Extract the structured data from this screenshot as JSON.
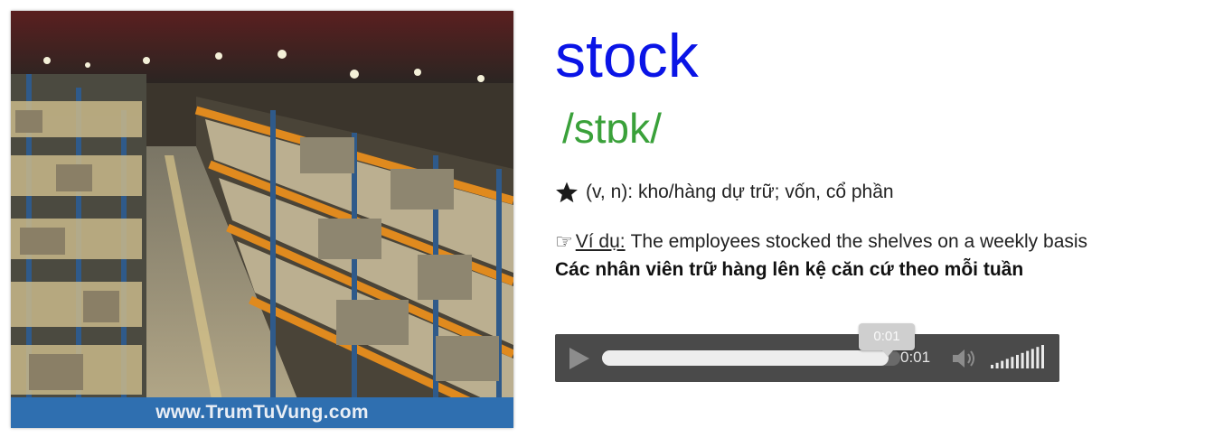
{
  "illustration": {
    "watermark": "www.TrumTuVung.com",
    "alt_icon": "warehouse-illustration"
  },
  "entry": {
    "word": "stock",
    "phonetic": "/stɒk/",
    "definition": "(v, n): kho/hàng dự trữ; vốn, cổ phần",
    "example_label": "Ví dụ:",
    "example_text": "The employees stocked the shelves on a weekly basis",
    "translation": "Các nhân viên trữ hàng lên kệ căn cứ theo mỗi tuần"
  },
  "player": {
    "current_time": "0:01",
    "tooltip_time": "0:01",
    "progress": 0.96,
    "volume_level": 1.0,
    "play_icon": "play-icon",
    "volume_icon": "speaker-icon"
  },
  "colors": {
    "word": "#0a14e6",
    "phonetic": "#3aa13a",
    "watermark_bg": "#2f6fb0",
    "player_bg": "#4a4a4a"
  }
}
